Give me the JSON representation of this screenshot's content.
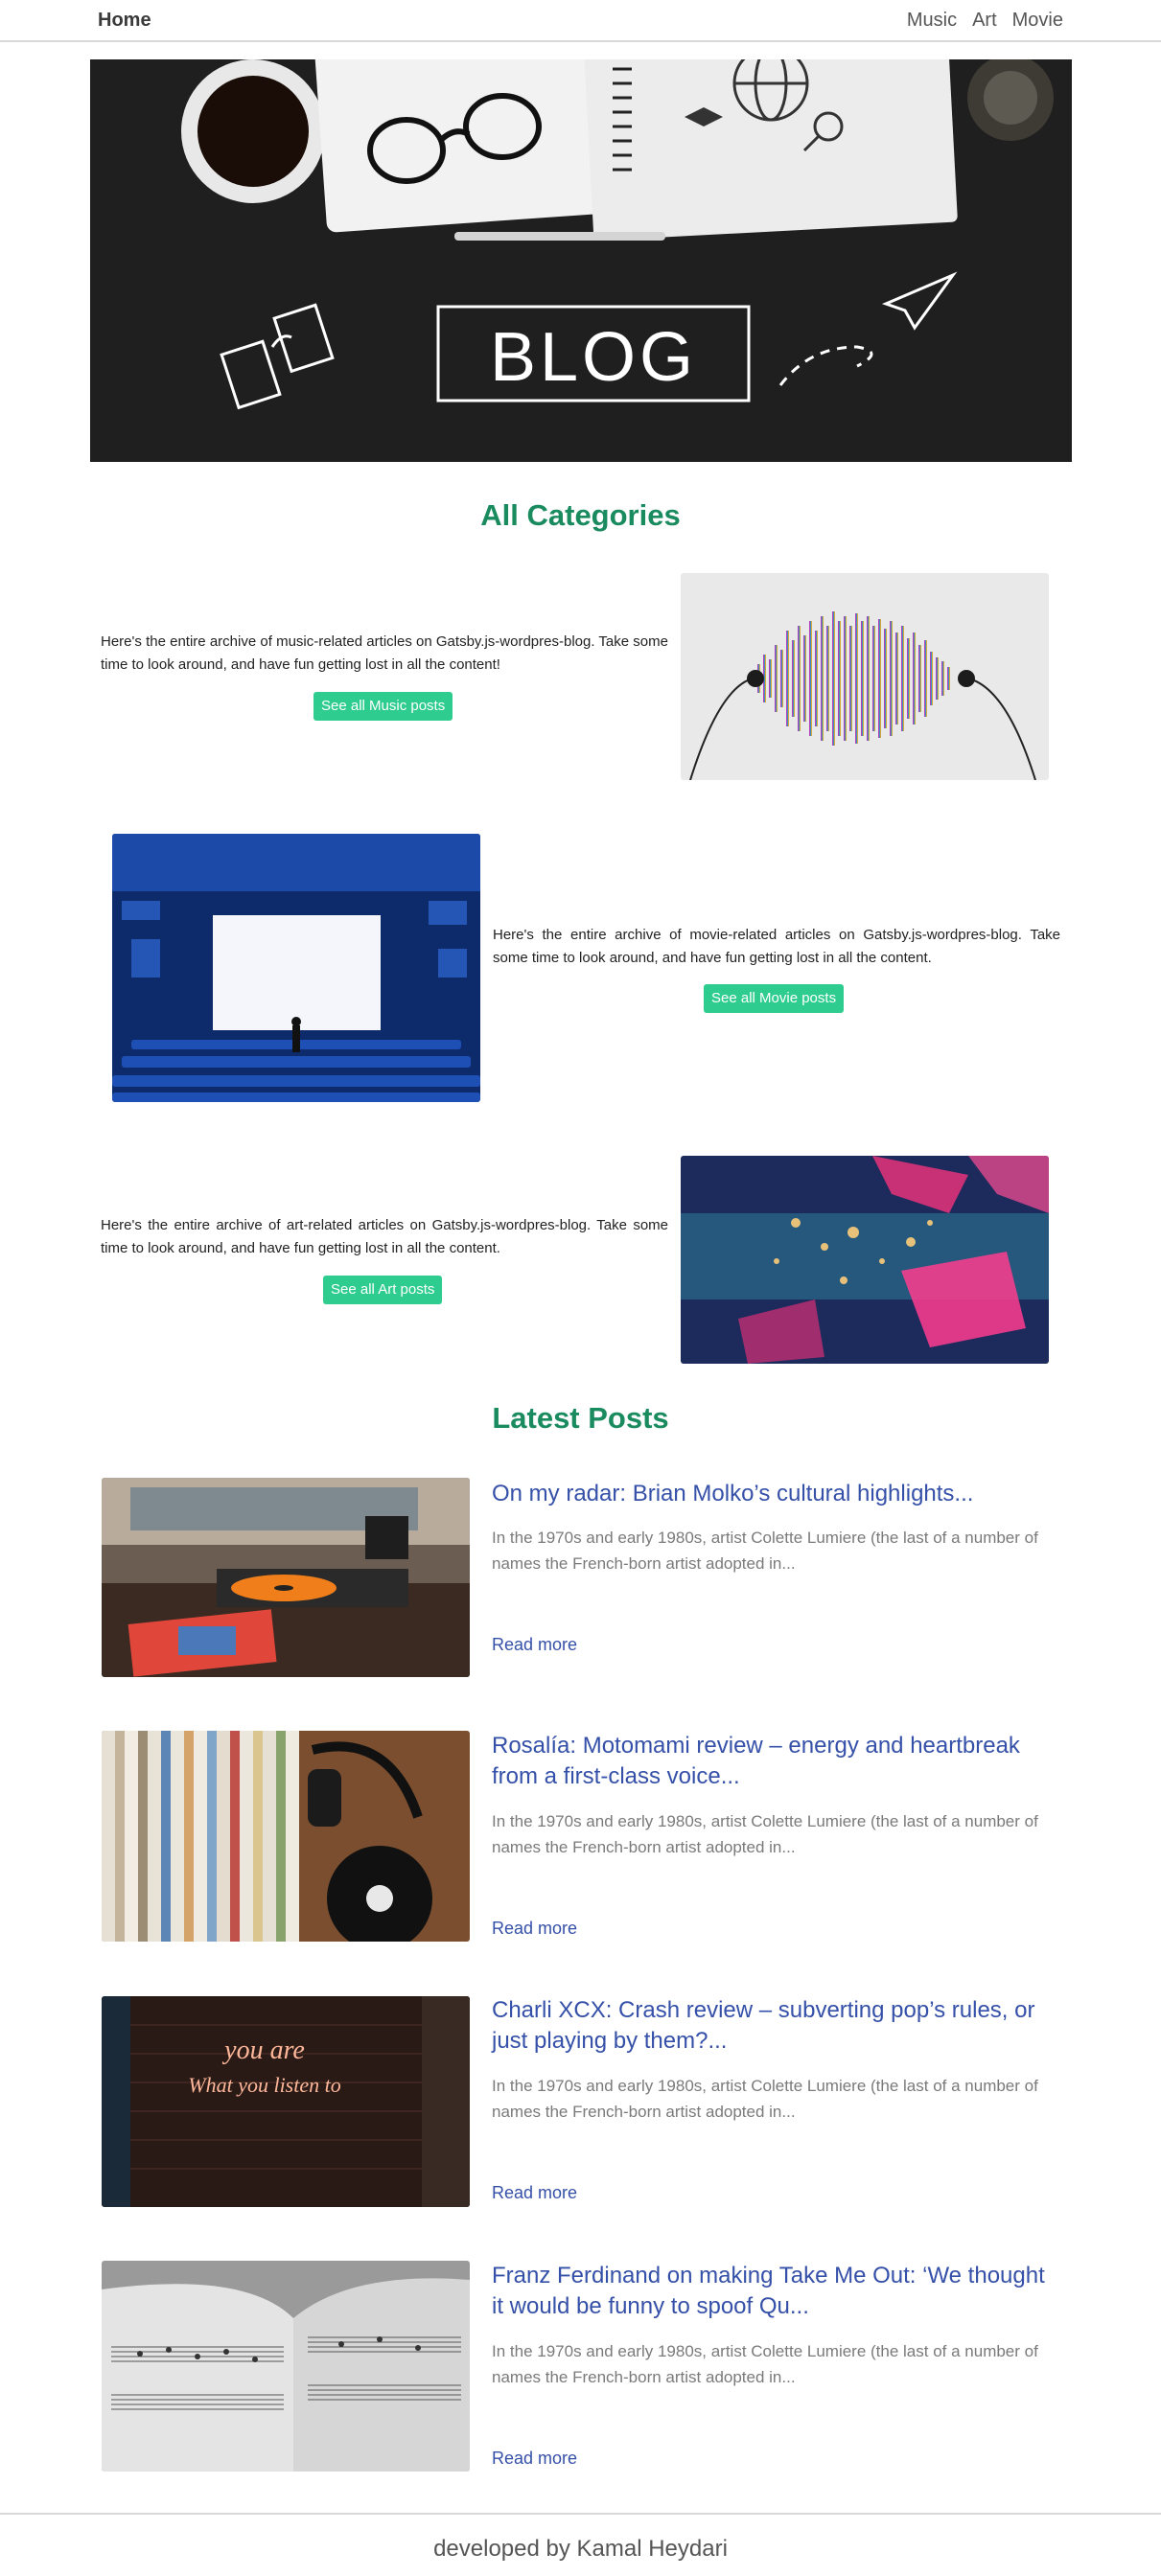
{
  "nav": {
    "home": "Home",
    "links": [
      "Music",
      "Art",
      "Movie"
    ]
  },
  "hero": {
    "sign_text": "BLOG"
  },
  "categories": {
    "title": "All Categories",
    "items": [
      {
        "text": "Here's the entire archive of music-related articles on Gatsby.js-wordpres-blog. Take some time to look around, and have fun getting lost in all the content!",
        "button": "See all Music posts",
        "image_icon": "sound-wave-headphones-image"
      },
      {
        "text": "Here's the entire archive of movie-related articles on Gatsby.js-wordpres-blog. Take some time to look around, and have fun getting lost in all the content.",
        "button": "See all Movie posts",
        "image_icon": "cinema-screen-image"
      },
      {
        "text": "Here's the entire archive of art-related articles on Gatsby.js-wordpres-blog. Take some time to look around, and have fun getting lost in all the content.",
        "button": "See all Art posts",
        "image_icon": "abstract-painting-image"
      }
    ]
  },
  "latest": {
    "title": "Latest Posts",
    "posts": [
      {
        "title": "On my radar: Brian Molko’s cultural highlights...",
        "excerpt": "In the 1970s and early 1980s, artist Colette Lumiere (the last of a number of names the French-born artist adopted in...",
        "link": "Read more"
      },
      {
        "title": "Rosalía: Motomami review – energy and heartbreak from a first-class voice...",
        "excerpt": "In the 1970s and early 1980s, artist Colette Lumiere (the last of a number of names the French-born artist adopted in...",
        "link": "Read more"
      },
      {
        "title": "Charli XCX: Crash review – subverting pop’s rules, or just playing by them?...",
        "excerpt": "In the 1970s and early 1980s, artist Colette Lumiere (the last of a number of names the French-born artist adopted in...",
        "link": "Read more"
      },
      {
        "title": "Franz Ferdinand on making Take Me Out: ‘We thought it would be funny to spoof Qu...",
        "excerpt": "In the 1970s and early 1980s, artist Colette Lumiere (the last of a number of names the French-born artist adopted in...",
        "link": "Read more"
      }
    ],
    "neon_sign": [
      "you are",
      "What you listen to"
    ]
  },
  "footer": {
    "text": "developed by Kamal Heydari"
  },
  "colors": {
    "accent_green": "#1a8a5f",
    "button_green": "#2ecc8f",
    "link_blue": "#3550a8"
  }
}
